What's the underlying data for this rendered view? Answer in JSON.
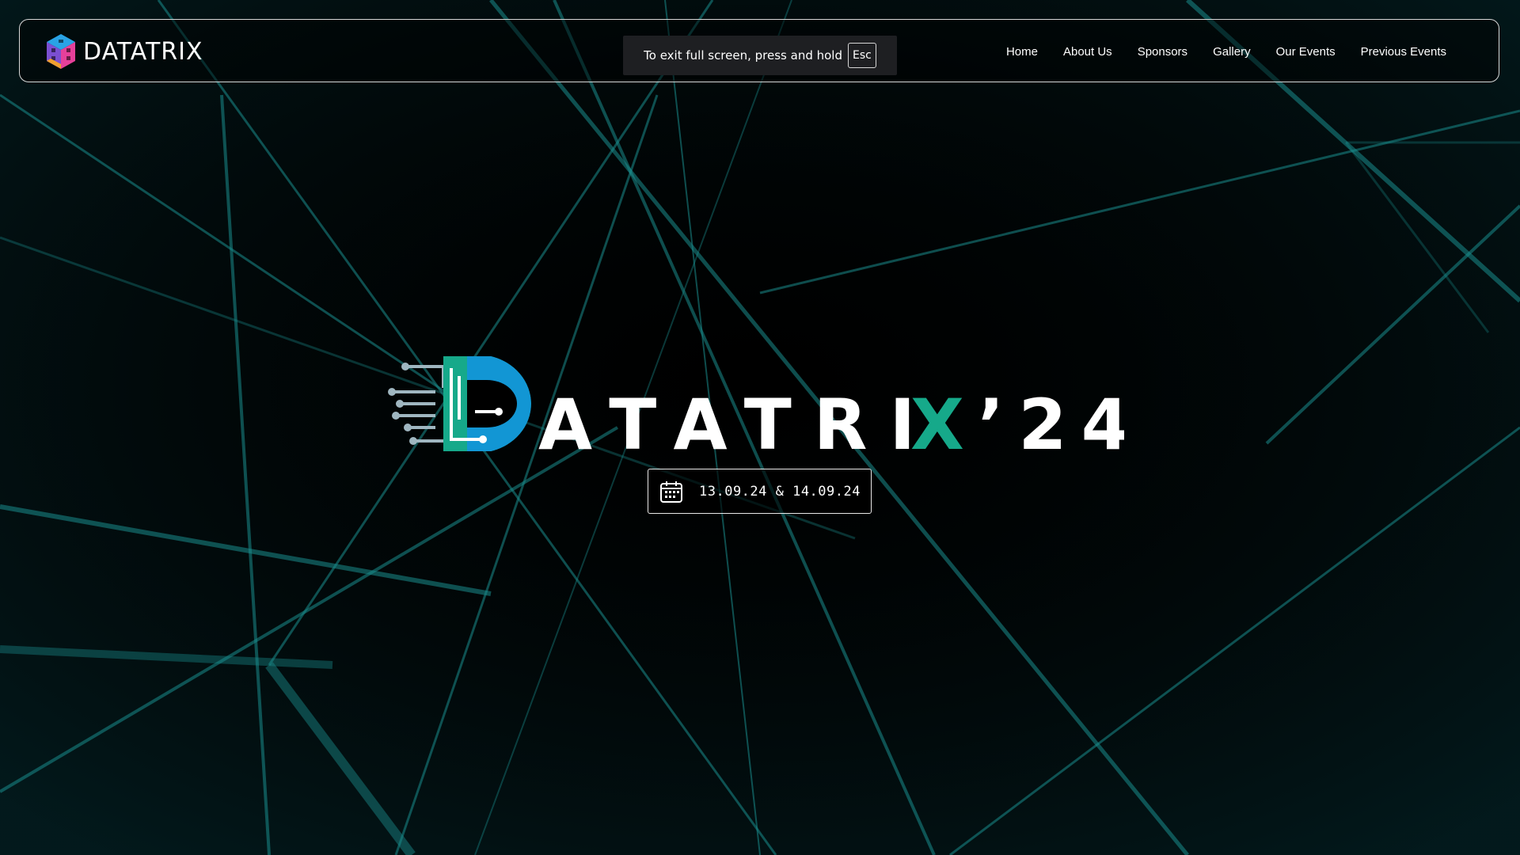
{
  "brand": {
    "name": "DATATRIX"
  },
  "nav": {
    "items": [
      {
        "label": "Home"
      },
      {
        "label": "About Us"
      },
      {
        "label": "Sponsors"
      },
      {
        "label": "Gallery"
      },
      {
        "label": "Our Events"
      },
      {
        "label": "Previous Events"
      }
    ]
  },
  "fullscreen_notice": {
    "text": "To exit full screen, press and hold",
    "key": "Esc"
  },
  "hero": {
    "title_main": "ATATRI",
    "title_x": "X",
    "title_suffix": "’24",
    "date_text": "13.09.24  & 14.09.24"
  },
  "colors": {
    "accent_teal": "#16a98a",
    "accent_blue": "#1296d4",
    "bg": "#000000"
  }
}
